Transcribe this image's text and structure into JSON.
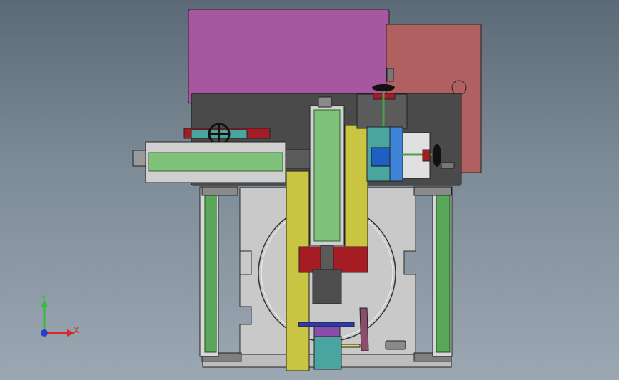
{
  "window": {
    "title": ""
  },
  "model": {
    "name": "",
    "colors": {
      "background": "#6f7d8a",
      "magenta_panel": "#a6579f",
      "salmon_panel": "#b06060",
      "dark_base": "#4a4a4a",
      "grey_plate": "#c9c9c9",
      "green_rail": "#5aa75a",
      "yellow_bracket": "#c9c441",
      "red_block": "#a51c24",
      "blue_block": "#1f5fc2",
      "teal_block": "#4aa4a0"
    }
  },
  "triad": {
    "x_label": "X",
    "y_label": "Y"
  }
}
